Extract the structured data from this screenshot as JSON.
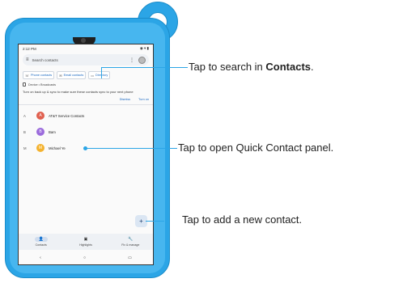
{
  "statusbar": {
    "time": "2:12 PM",
    "indicators": "◉ ▾ ▮"
  },
  "search": {
    "placeholder": "Search contacts"
  },
  "chips": [
    {
      "icon": "phone-icon",
      "label": "Phone contacts"
    },
    {
      "icon": "email-icon",
      "label": "Email contacts"
    },
    {
      "icon": "label-icon",
      "label": "Directory"
    }
  ],
  "backup": {
    "title": "Device • Broadcasts",
    "message": "Turn on back up & sync to make sure these contacts sync to your next phone",
    "dismiss": "Dismiss",
    "turn_on": "Turn on"
  },
  "contacts": [
    {
      "letter": "A",
      "initial": "A",
      "name": "AT&T Service Contacts",
      "color": "#e0604f"
    },
    {
      "letter": "B",
      "initial": "B",
      "name": "Bam",
      "color": "#9b6bdc"
    },
    {
      "letter": "M",
      "initial": "M",
      "name": "Michael Ye",
      "color": "#f4b22e"
    }
  ],
  "fab": {
    "label": "+"
  },
  "bottomnav": [
    {
      "icon": "person-icon",
      "glyph": "👤",
      "label": "Contacts"
    },
    {
      "icon": "highlights-icon",
      "glyph": "▣",
      "label": "Highlights"
    },
    {
      "icon": "wrench-icon",
      "glyph": "🔧",
      "label": "Fix & manage"
    }
  ],
  "sysnav": {
    "back": "‹",
    "home": "○",
    "recents": "▭"
  },
  "callouts": {
    "search_pre": "Tap to search in ",
    "search_bold": "Contacts",
    "search_post": ".",
    "quick_contact": "Tap to open Quick Contact panel.",
    "add_contact": "Tap to add a new contact."
  },
  "colors": {
    "case": "#2ba5e6",
    "accent": "#1565c0"
  }
}
